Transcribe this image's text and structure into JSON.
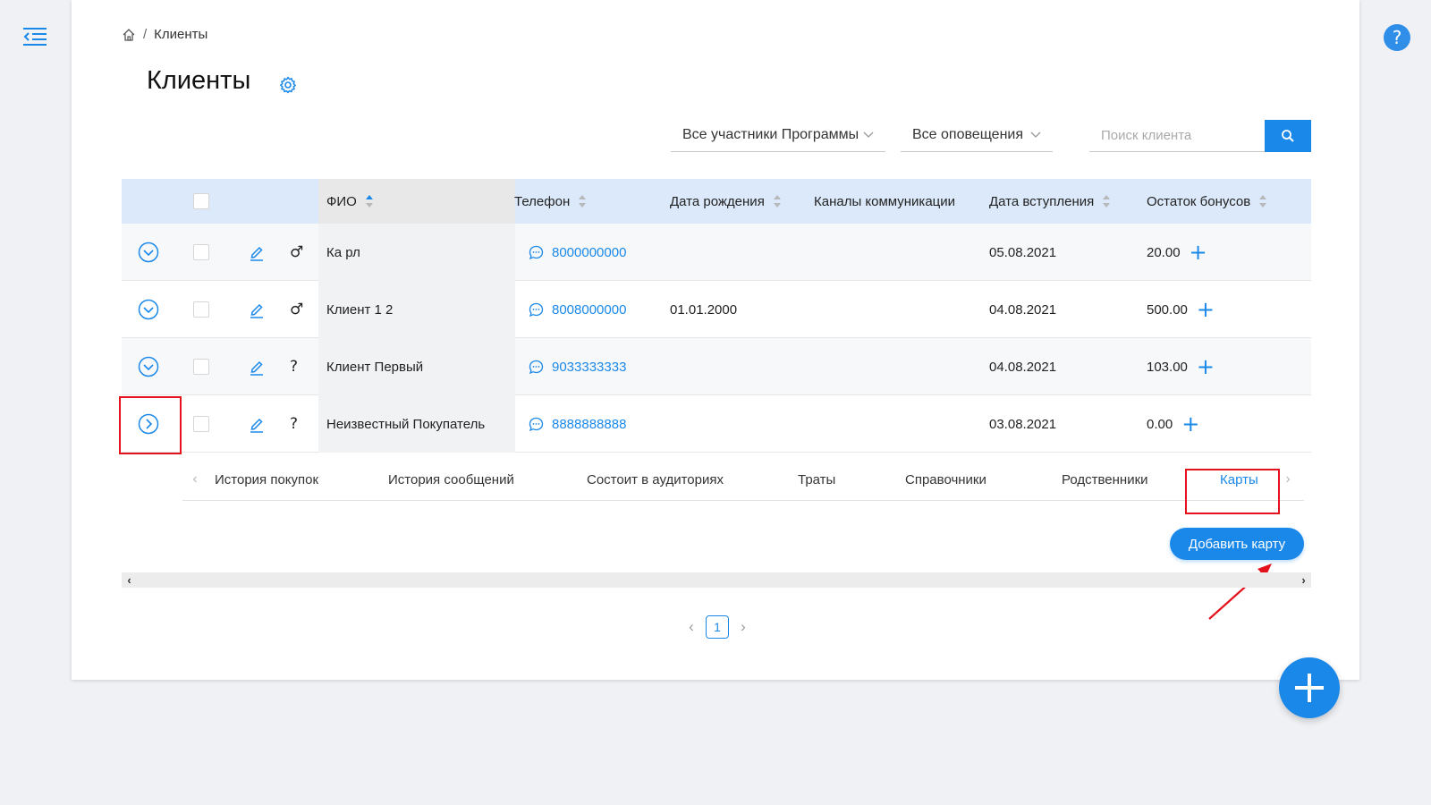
{
  "breadcrumb": {
    "current": "Клиенты"
  },
  "page": {
    "title": "Клиенты"
  },
  "filters": {
    "participants": "Все участники Программы",
    "notifications": "Все оповещения",
    "search_placeholder": "Поиск клиента"
  },
  "table": {
    "columns": {
      "fio": "ФИО",
      "phone": "Телефон",
      "birth": "Дата рождения",
      "channels": "Каналы коммуникации",
      "joined": "Дата вступления",
      "bonus": "Остаток бонусов"
    },
    "rows": [
      {
        "gender": "♂",
        "name": "Ка рл",
        "phone": "8000000000",
        "birth": "",
        "joined": "05.08.2021",
        "bonus": "20.00",
        "expanded": false
      },
      {
        "gender": "♂",
        "name": "Клиент 1 2",
        "phone": "8008000000",
        "birth": "01.01.2000",
        "joined": "04.08.2021",
        "bonus": "500.00",
        "expanded": false
      },
      {
        "gender": "?",
        "name": "Клиент Первый",
        "phone": "9033333333",
        "birth": "",
        "joined": "04.08.2021",
        "bonus": "103.00",
        "expanded": false
      },
      {
        "gender": "?",
        "name": "Неизвестный Покупатель",
        "phone": "8888888888",
        "birth": "",
        "joined": "03.08.2021",
        "bonus": "0.00",
        "expanded": true
      }
    ]
  },
  "tabs": {
    "purchases": "История покупок",
    "messages": "История сообщений",
    "audiences": "Состоит в аудиториях",
    "spending": "Траты",
    "references": "Справочники",
    "relatives": "Родственники",
    "cards": "Карты",
    "active": "cards"
  },
  "actions": {
    "add_card": "Добавить карту"
  },
  "pagination": {
    "current_page": "1"
  },
  "help": {
    "label": "?"
  },
  "colors": {
    "accent": "#1a88e8",
    "header_bg": "#dbe9fa",
    "annotation": "#e3121c"
  }
}
